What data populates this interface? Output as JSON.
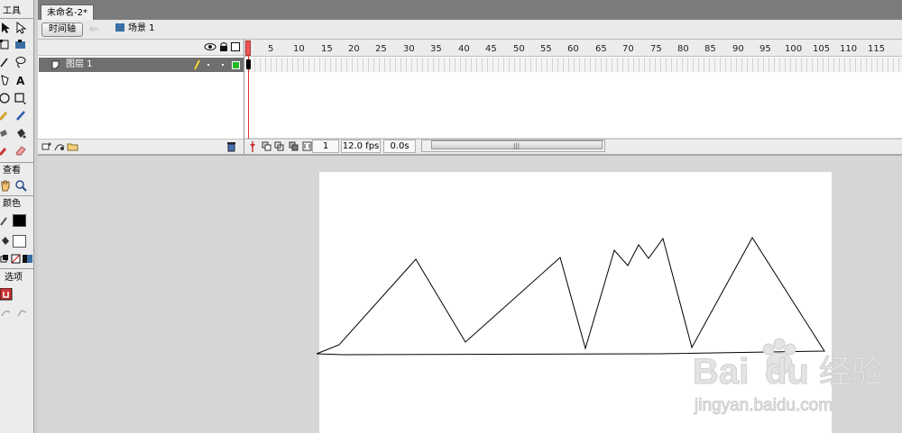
{
  "tools_panel": {
    "tools_header": "工具",
    "view_header": "查看",
    "colors_header": "颜色",
    "options_header": "选项"
  },
  "document": {
    "tab_title": "未命名-2*"
  },
  "timeline": {
    "toggle_label": "时间轴",
    "scene_label": "场景 1",
    "layer_name": "图层 1",
    "ruler_numbers": [
      "5",
      "10",
      "15",
      "20",
      "25",
      "30",
      "35",
      "40",
      "45",
      "50",
      "55",
      "60",
      "65",
      "70",
      "75",
      "80",
      "85",
      "90",
      "95",
      "100",
      "105",
      "110",
      "115"
    ],
    "current_frame": "1",
    "frame_rate": "12.0 fps",
    "elapsed_time": "0.0s"
  },
  "watermark": {
    "brand": "Baidu",
    "brand_cn": "经验",
    "url": "jingyan.baidu.com"
  },
  "colors": {
    "layer_selected": "#6f6f6f",
    "playhead": "#e55555",
    "layer_outline_swatch": "#22bb22"
  },
  "icons": {
    "tools": [
      "arrow-icon",
      "subselect-icon",
      "free-transform-icon",
      "gradient-transform-icon",
      "line-icon",
      "lasso-icon",
      "pen-icon",
      "text-icon",
      "oval-icon",
      "rectangle-icon",
      "pencil-icon",
      "brush-icon",
      "ink-bottle-icon",
      "paint-bucket-icon",
      "eyedropper-icon",
      "eraser-icon"
    ],
    "view": [
      "hand-icon",
      "zoom-icon"
    ]
  }
}
